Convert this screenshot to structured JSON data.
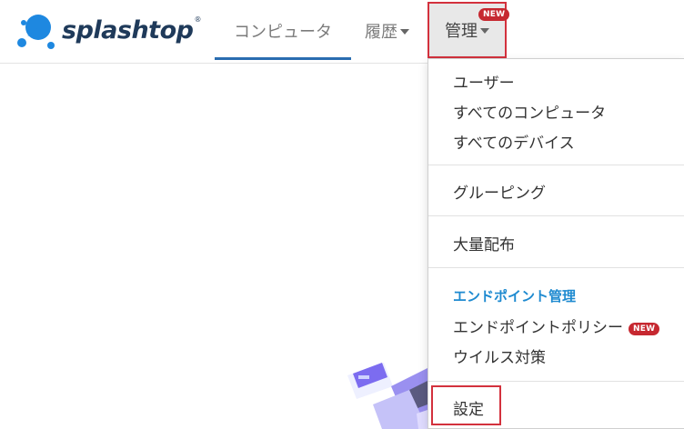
{
  "brand": {
    "name": "splashtop",
    "registered_mark": "®",
    "logo_color": "#1f3a5a",
    "accent_color": "#2a6db0"
  },
  "nav": {
    "computers_label": "コンピュータ",
    "history_label": "履歴",
    "admin_label": "管理",
    "admin_badge": "NEW"
  },
  "dropdown": {
    "items_group1": [
      "ユーザー",
      "すべてのコンピュータ",
      "すべてのデバイス"
    ],
    "grouping_label": "グルーピング",
    "mass_deploy_label": "大量配布",
    "endpoint_header": "エンドポイント管理",
    "endpoint_policy_label": "エンドポイントポリシー",
    "endpoint_policy_badge": "NEW",
    "antivirus_label": "ウイルス対策",
    "settings_label": "設定"
  },
  "colors": {
    "highlight_red": "#d3313d",
    "badge_red": "#c62830",
    "header_blue": "#1e8ad0"
  }
}
